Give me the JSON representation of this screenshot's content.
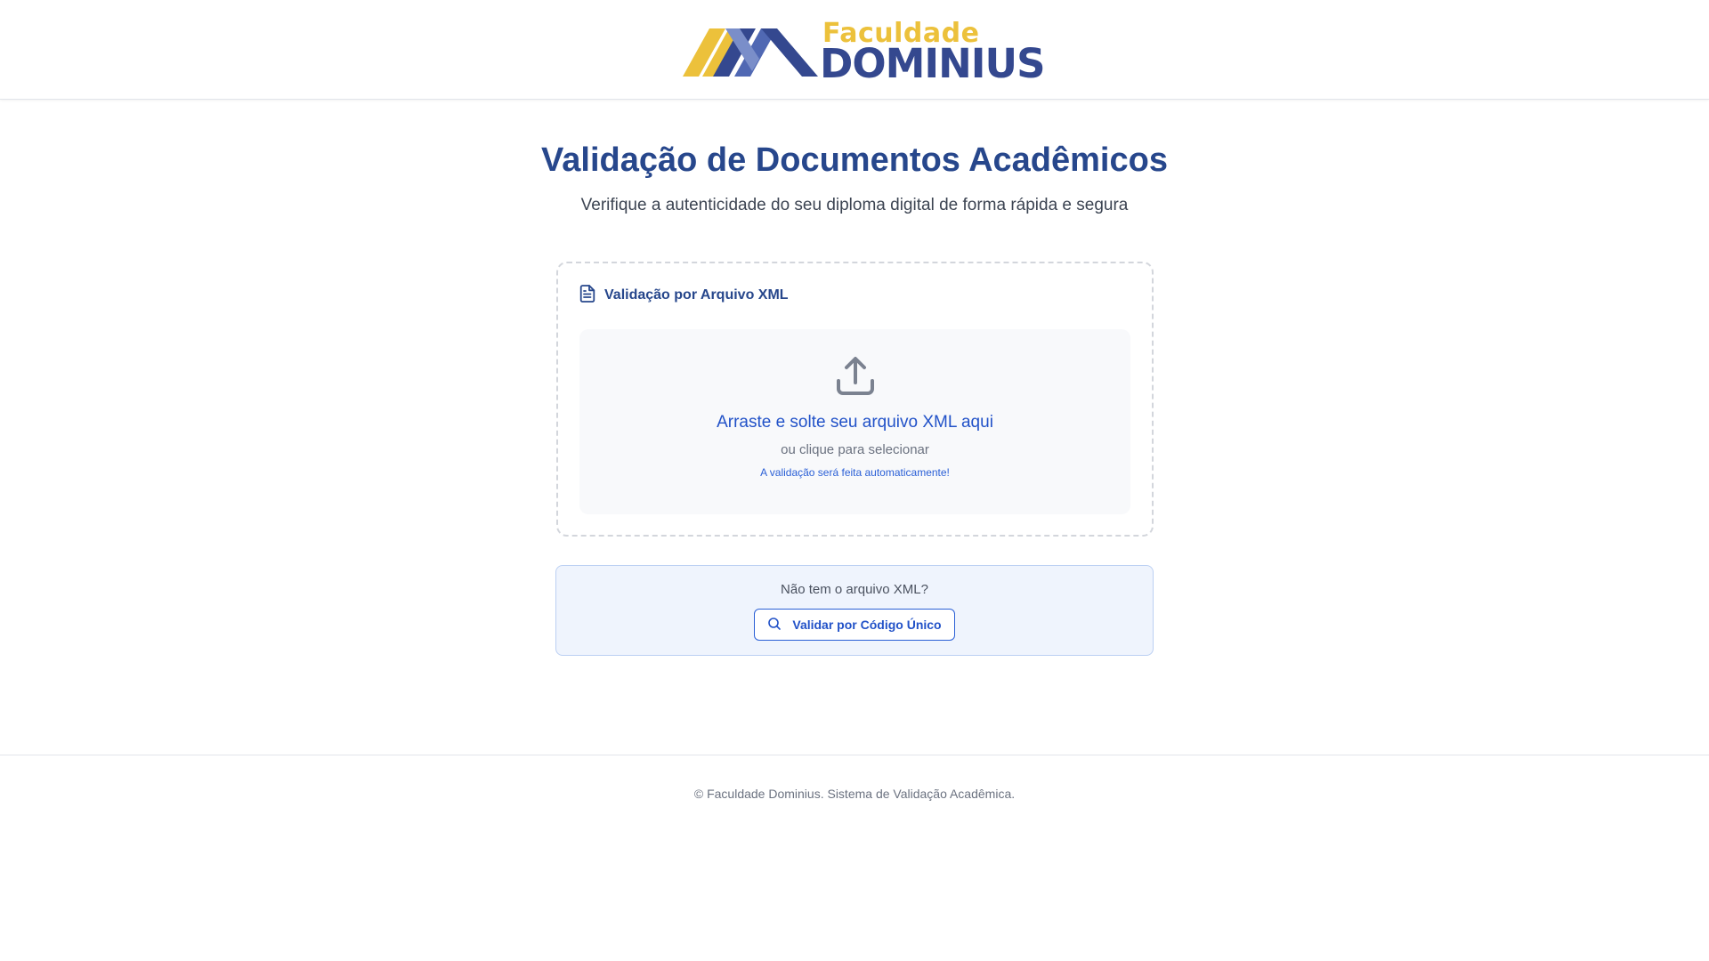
{
  "header": {
    "logo": {
      "line1": "Faculdade",
      "line2": "DOMINIUS",
      "colors": {
        "gold": "#ecc13b",
        "navy": "#34488f",
        "blue": "#4a63ae"
      }
    }
  },
  "main": {
    "title": "Validação de Documentos Acadêmicos",
    "subtitle": "Verifique a autenticidade do seu diploma digital de forma rápida e segura"
  },
  "xml_card": {
    "icon": "file-text-icon",
    "title": "Validação por Arquivo XML",
    "dropzone": {
      "icon": "upload-icon",
      "title": "Arraste e solte seu arquivo XML aqui",
      "subtitle": "ou clique para selecionar",
      "note": "A validação será feita automaticamente!"
    }
  },
  "code_box": {
    "question": "Não tem o arquivo XML?",
    "button": {
      "icon": "search-icon",
      "label": "Validar por Código Único"
    }
  },
  "footer": {
    "text": "© Faculdade Dominius. Sistema de Validação Acadêmica."
  },
  "colors": {
    "primary": "#27478c",
    "link": "#2252c8",
    "muted": "#6b7280",
    "code_box_bg": "#eff4fd",
    "code_box_border": "#bcd0f3"
  }
}
